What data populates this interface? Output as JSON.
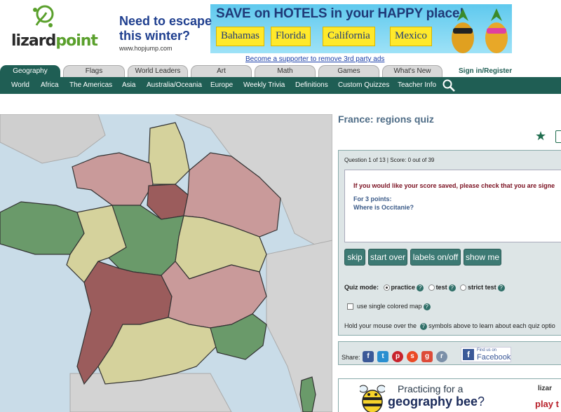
{
  "logo": {
    "text_a": "lizard",
    "text_b": "point"
  },
  "ad": {
    "headline_line1": "Need to escape",
    "headline_line2": "this winter?",
    "url": "www.hopjump.com",
    "banner": "SAVE on HOTELS in your HAPPY place!",
    "destinations": [
      "Bahamas",
      "Florida",
      "California",
      "Mexico"
    ]
  },
  "support_link": "Become a supporter to remove 3rd party ads",
  "tabs": [
    "Geography",
    "Flags",
    "World Leaders",
    "Art",
    "Math",
    "Games",
    "What's New"
  ],
  "signin": "Sign in/Register",
  "subnav": [
    "World",
    "Africa",
    "The Americas",
    "Asia",
    "Australia/Oceania",
    "Europe",
    "Weekly Trivia",
    "Definitions",
    "Custom Quizzes",
    "Teacher Info"
  ],
  "quiz": {
    "title": "France: regions quiz",
    "question_info": "Question 1 of 13 | Score: 0 out of 39",
    "saved_msg": "If you would like your score saved, please check that you are signe",
    "points": "For 3 points:",
    "question": "Where is Occitanie?",
    "buttons": [
      "skip",
      "start over",
      "labels on/off",
      "show me"
    ],
    "mode_label": "Quiz mode:",
    "modes": [
      "practice",
      "test",
      "strict test"
    ],
    "single_color": "use single colored map",
    "hold_msg_a": "Hold your mouse over the",
    "hold_msg_b": "symbols above to learn about each quiz optio"
  },
  "share": {
    "label": "Share:",
    "fb_small": "Find us on",
    "fb_big": "Facebook"
  },
  "bee_ad": {
    "line1": "Practicing for a",
    "line2": "geography bee",
    "line2_q": "?",
    "brand": "lizar",
    "play": "play t"
  },
  "colors": {
    "brand_green": "#1f5e54",
    "region_green": "#6a9a6a",
    "region_pink": "#c99a9a",
    "region_tan": "#d5d29c",
    "region_brown": "#9b5c5c",
    "sea": "#c9dce8"
  }
}
